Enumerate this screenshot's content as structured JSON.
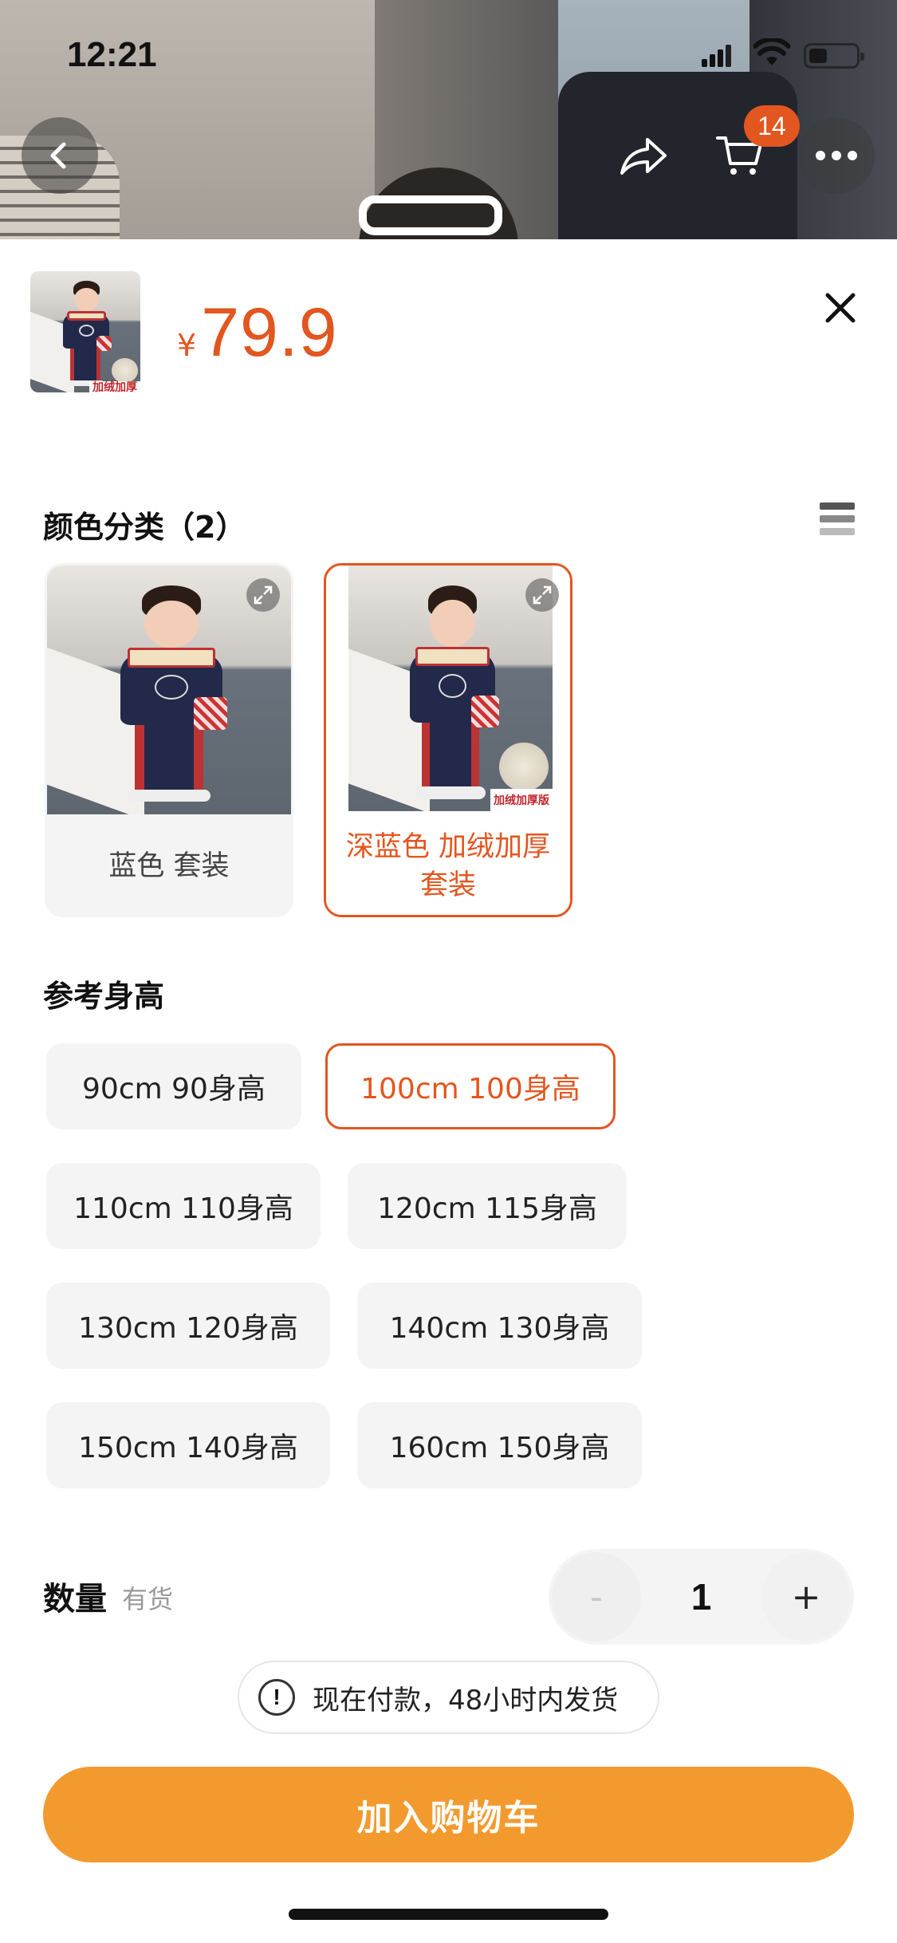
{
  "status_bar": {
    "time": "12:21"
  },
  "header": {
    "cart_badge": "14"
  },
  "product": {
    "thumb_tag": "加绒加厚",
    "currency": "¥",
    "price": "79.9"
  },
  "color_section": {
    "title": "颜色分类（2）",
    "options": [
      {
        "label": "蓝色 套装",
        "selected": false
      },
      {
        "label": "深蓝色 加绒加厚套装",
        "selected": true,
        "tag": "加绒加厚版"
      }
    ]
  },
  "height_section": {
    "title": "参考身高",
    "options": [
      {
        "label": "90cm 90身高",
        "selected": false
      },
      {
        "label": "100cm 100身高",
        "selected": true
      },
      {
        "label": "110cm 110身高",
        "selected": false
      },
      {
        "label": "120cm 115身高",
        "selected": false
      },
      {
        "label": "130cm 120身高",
        "selected": false
      },
      {
        "label": "140cm 130身高",
        "selected": false
      },
      {
        "label": "150cm 140身高",
        "selected": false
      },
      {
        "label": "160cm 150身高",
        "selected": false
      }
    ]
  },
  "quantity": {
    "label": "数量",
    "stock": "有货",
    "minus": "-",
    "value": "1",
    "plus": "+"
  },
  "notice": {
    "icon": "!",
    "text": "现在付款，48小时内发货"
  },
  "cta": {
    "label": "加入购物车"
  },
  "colors": {
    "accent": "#e2561f",
    "cta": "#f39a2f"
  }
}
